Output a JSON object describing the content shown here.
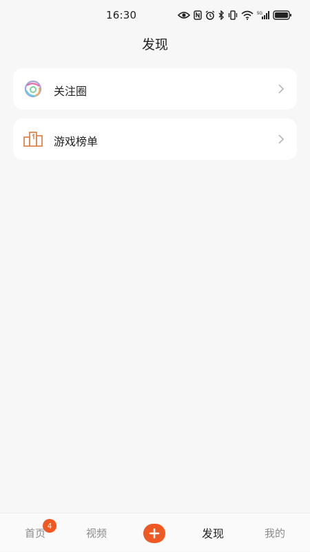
{
  "status_bar": {
    "time": "16:30",
    "icons": [
      "eye-icon",
      "nfc-icon",
      "alarm-icon",
      "bluetooth-icon",
      "vibrate-icon",
      "wifi-icon",
      "signal-5g-icon",
      "battery-icon"
    ]
  },
  "header": {
    "title": "发现"
  },
  "list": {
    "items": [
      {
        "label": "关注圈",
        "icon": "circle-rings-icon"
      },
      {
        "label": "游戏榜单",
        "icon": "podium-icon"
      }
    ]
  },
  "tab_bar": {
    "tabs": [
      {
        "label": "首页",
        "badge": "4"
      },
      {
        "label": "视频"
      },
      {
        "label": "发现",
        "active": true
      },
      {
        "label": "我的"
      }
    ],
    "accent_color": "#ef5a24"
  }
}
